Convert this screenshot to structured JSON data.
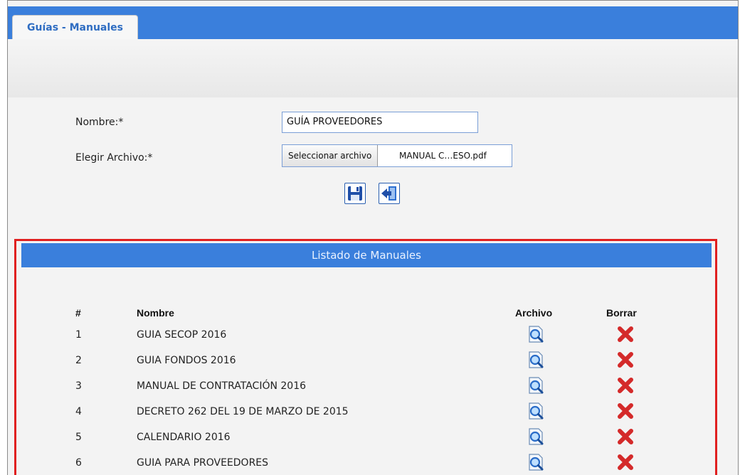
{
  "tab": {
    "label": "Guías - Manuales"
  },
  "form": {
    "nombre_label": "Nombre:*",
    "nombre_value": "GUÍA PROVEEDORES",
    "archivo_label": "Elegir Archivo:*",
    "file_button_label": "Seleccionar archivo",
    "file_name": "MANUAL C…ESO.pdf"
  },
  "actions": {
    "save_icon": "save-icon",
    "back_icon": "back-icon"
  },
  "list": {
    "title": "Listado de Manuales",
    "headers": {
      "num": "#",
      "nombre": "Nombre",
      "archivo": "Archivo",
      "borrar": "Borrar"
    },
    "rows": [
      {
        "num": "1",
        "nombre": "GUIA SECOP 2016"
      },
      {
        "num": "2",
        "nombre": "GUIA FONDOS 2016"
      },
      {
        "num": "3",
        "nombre": "MANUAL DE CONTRATACIÓN 2016"
      },
      {
        "num": "4",
        "nombre": "DECRETO 262 DEL 19 DE MARZO DE 2015"
      },
      {
        "num": "5",
        "nombre": "CALENDARIO 2016"
      },
      {
        "num": "6",
        "nombre": "GUIA PARA PROVEEDORES"
      }
    ]
  },
  "colors": {
    "accent": "#3a7fdc",
    "highlight": "#e02020",
    "delete": "#d42a2a"
  }
}
